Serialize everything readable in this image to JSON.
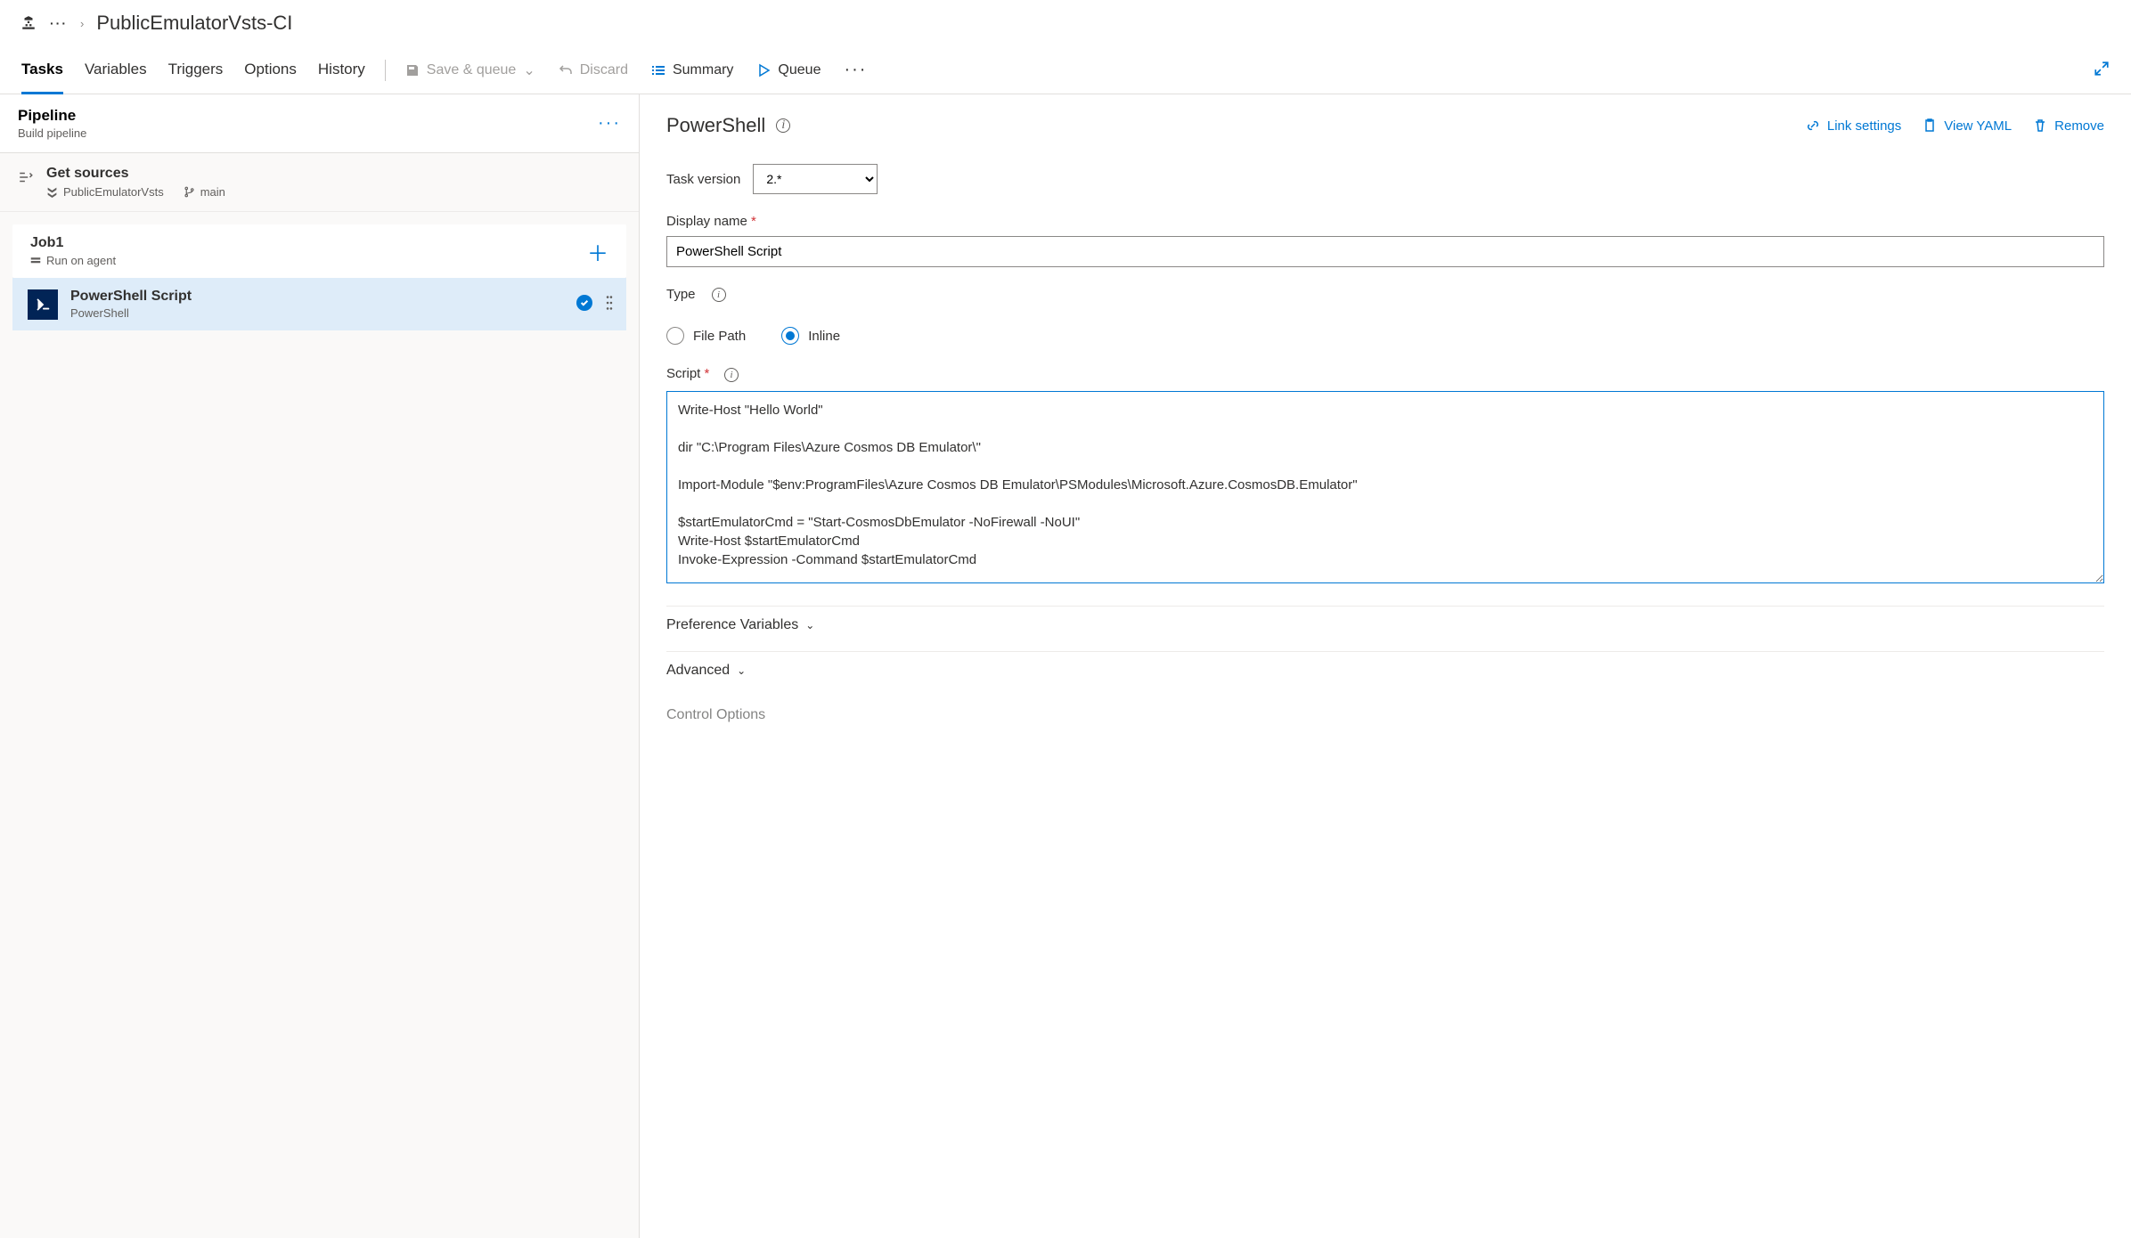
{
  "breadcrumb": {
    "title": "PublicEmulatorVsts-CI"
  },
  "tabs": {
    "tasks": "Tasks",
    "variables": "Variables",
    "triggers": "Triggers",
    "options": "Options",
    "history": "History"
  },
  "toolbar": {
    "save_queue": "Save & queue",
    "discard": "Discard",
    "summary": "Summary",
    "queue": "Queue"
  },
  "left": {
    "pipeline_title": "Pipeline",
    "pipeline_subtitle": "Build pipeline",
    "get_sources_title": "Get sources",
    "get_sources_repo": "PublicEmulatorVsts",
    "get_sources_branch": "main",
    "job_title": "Job1",
    "job_subtitle": "Run on agent",
    "task_title": "PowerShell Script",
    "task_subtitle": "PowerShell"
  },
  "right": {
    "heading": "PowerShell",
    "actions": {
      "link_settings": "Link settings",
      "view_yaml": "View YAML",
      "remove": "Remove"
    },
    "task_version_label": "Task version",
    "task_version_value": "2.*",
    "display_name_label": "Display name",
    "display_name_value": "PowerShell Script",
    "type_label": "Type",
    "type_options": {
      "filepath": "File Path",
      "inline": "Inline"
    },
    "type_selected": "inline",
    "script_label": "Script",
    "script_value": "Write-Host \"Hello World\"\n\ndir \"C:\\Program Files\\Azure Cosmos DB Emulator\\\"\n\nImport-Module \"$env:ProgramFiles\\Azure Cosmos DB Emulator\\PSModules\\Microsoft.Azure.CosmosDB.Emulator\"\n\n$startEmulatorCmd = \"Start-CosmosDbEmulator -NoFirewall -NoUI\"\nWrite-Host $startEmulatorCmd\nInvoke-Expression -Command $startEmulatorCmd",
    "sections": {
      "preference_variables": "Preference Variables",
      "advanced": "Advanced",
      "control_options": "Control Options"
    }
  }
}
